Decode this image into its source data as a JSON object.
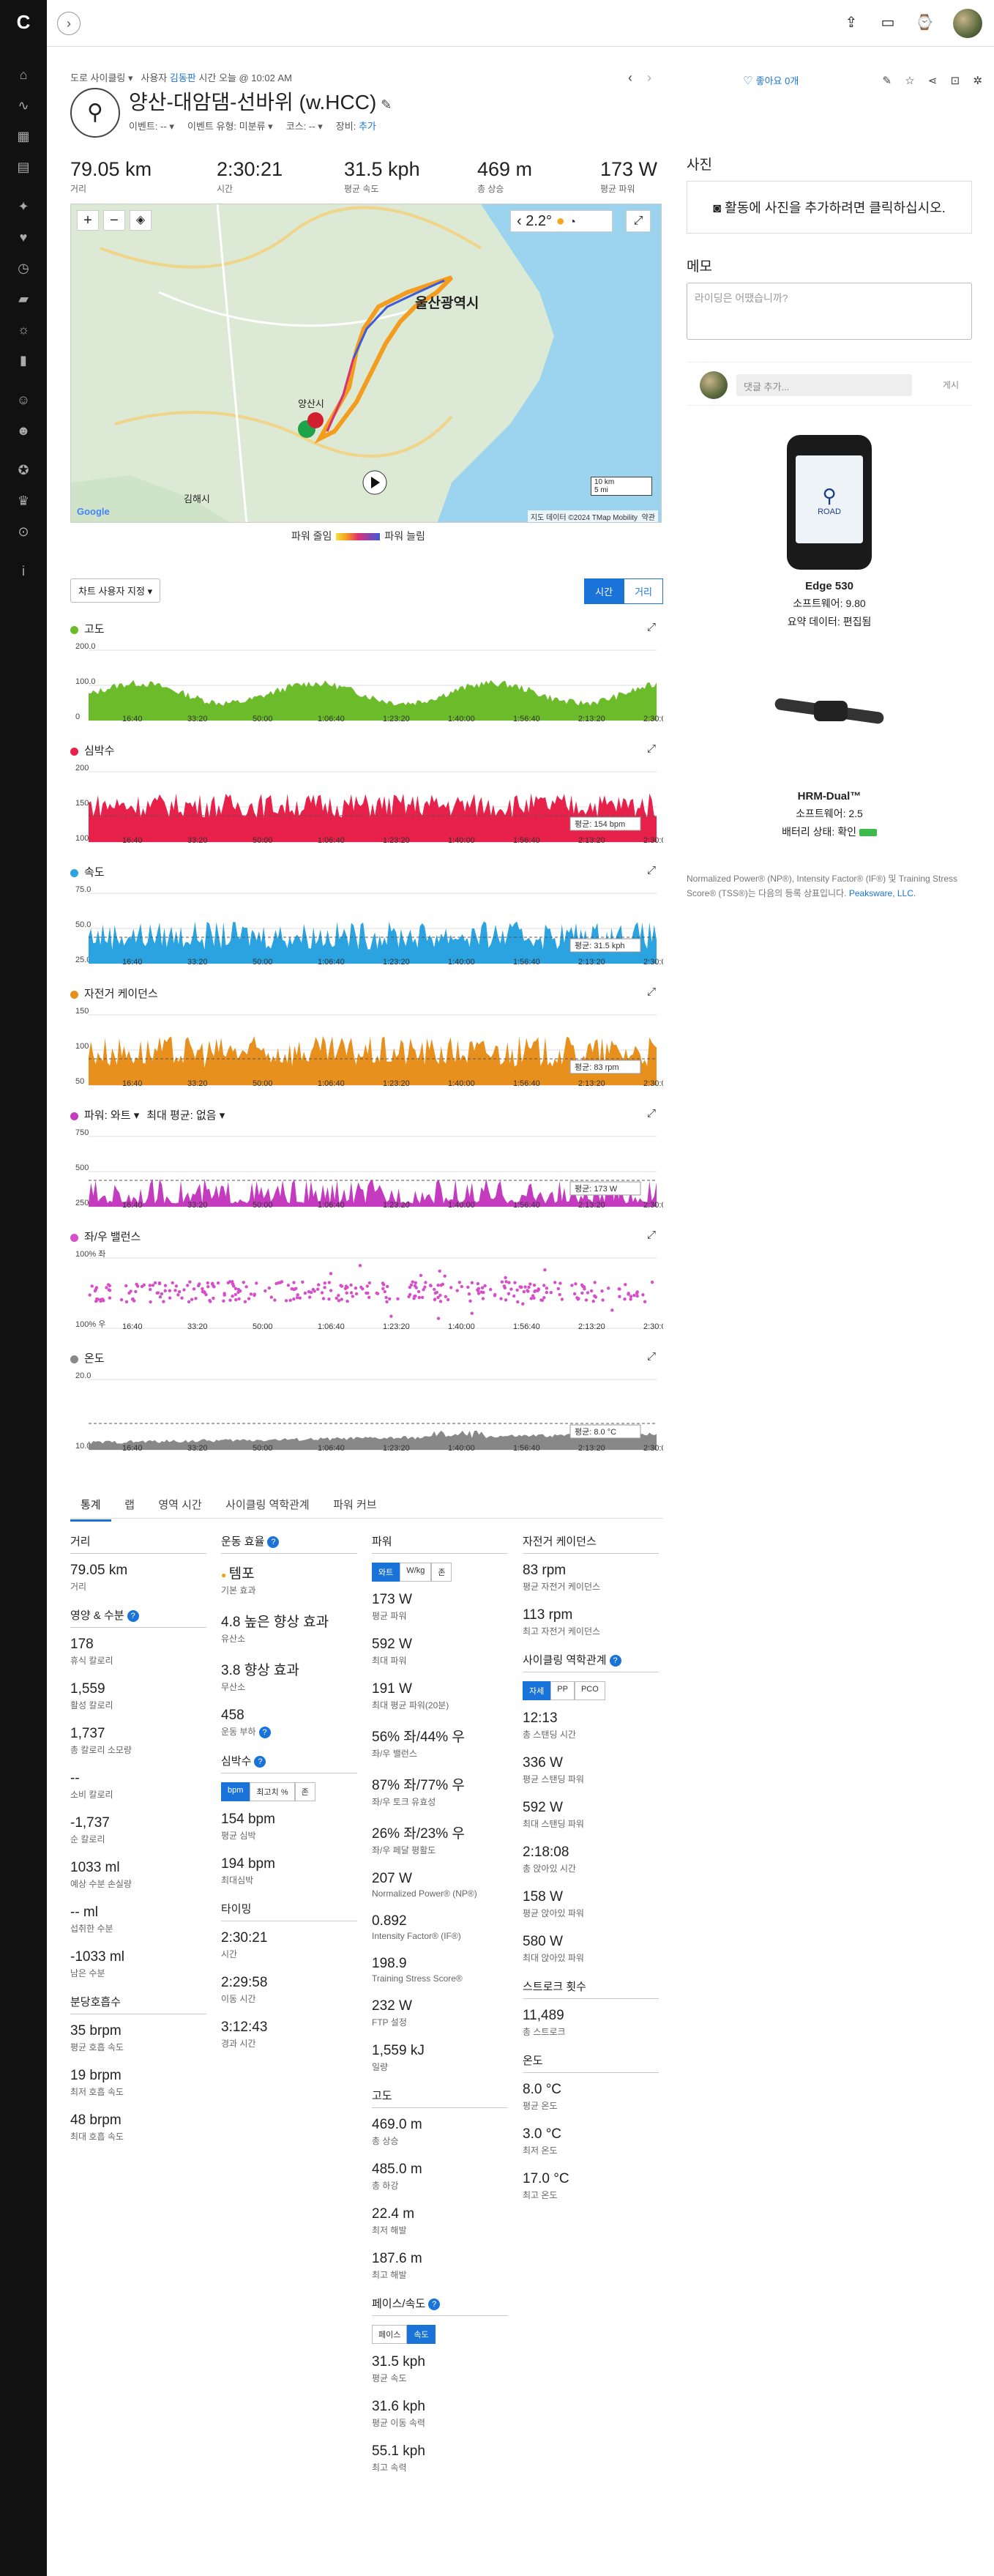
{
  "topbar": {
    "collapse_icon": "chevron-right",
    "icons": [
      "upload-icon",
      "inbox-icon",
      "watch-icon",
      "avatar"
    ]
  },
  "crumb": {
    "activity_type": "도로 사이클링",
    "user_prefix": "사용자",
    "user_name": "김동판",
    "time_prefix": "시간",
    "time_value": "오늘 @ 10:02 AM"
  },
  "activity": {
    "title": "양산-대암댐-선바위 (w.HCC)",
    "event_label": "이벤트:",
    "event_value": "--",
    "event_type_label": "이벤트 유형:",
    "event_type_value": "미분류",
    "course_label": "코스:",
    "course_value": "--",
    "gear_label": "장비:",
    "gear_value": "추가",
    "like_label": "좋아요 0개"
  },
  "summary": [
    {
      "value": "79.05 km",
      "label": "거리"
    },
    {
      "value": "2:30:21",
      "label": "시간"
    },
    {
      "value": "31.5 kph",
      "label": "평균 속도"
    },
    {
      "value": "469 m",
      "label": "총 상승"
    },
    {
      "value": "173 W",
      "label": "평균 파워"
    }
  ],
  "map": {
    "city_label": "울산광역시",
    "town_label": "양산시",
    "town2_label": "김해시",
    "temp": "2.2°",
    "scale_km": "10 km",
    "scale_mi": "5 mi",
    "attribution": "지도 데이터 ©2024 TMap Mobility",
    "terms": "약관",
    "google": "Google",
    "legend_low": "파워 줄임",
    "legend_high": "파워 늘림"
  },
  "chart_controls": {
    "customize": "차트 사용자 지정",
    "time": "시간",
    "distance": "거리"
  },
  "charts": [
    {
      "key": "elev",
      "title": "고도",
      "color": "#6cbb2a",
      "ticks": [
        "200.0",
        "100.0",
        "0"
      ],
      "avg": ""
    },
    {
      "key": "hr",
      "title": "심박수",
      "color": "#e8214a",
      "ticks": [
        "200",
        "150",
        "100"
      ],
      "avg": "평균: 154 bpm"
    },
    {
      "key": "speed",
      "title": "속도",
      "color": "#2aa3e0",
      "ticks": [
        "75.0",
        "50.0",
        "25.0"
      ],
      "avg": "평균: 31.5 kph"
    },
    {
      "key": "cad",
      "title": "자전거 케이던스",
      "color": "#e8901e",
      "ticks": [
        "150",
        "100",
        "50"
      ],
      "avg": "평균: 83 rpm"
    },
    {
      "key": "power",
      "title": "파워: 와트",
      "extra": "최대 평균: 없음",
      "color": "#c53bc0",
      "ticks": [
        "750",
        "500",
        "250"
      ],
      "avg": "평균: 173 W"
    },
    {
      "key": "balance",
      "title": "좌/우 밸런스",
      "color": "#d64fc8",
      "ticks": [
        "100% 좌",
        "100% 우"
      ],
      "avg": ""
    },
    {
      "key": "temp",
      "title": "온도",
      "color": "#888888",
      "ticks": [
        "20.0",
        "10.0"
      ],
      "avg": "평균: 8.0 °C"
    }
  ],
  "x_ticks": [
    "16:40",
    "33:20",
    "50:00",
    "1:06:40",
    "1:23:20",
    "1:40:00",
    "1:56:40",
    "2:13:20",
    "2:30:00"
  ],
  "tabs": [
    "통계",
    "랩",
    "영역 시간",
    "사이클링 역학관계",
    "파워 커브"
  ],
  "stats": {
    "distance": {
      "head": "거리",
      "items": [
        {
          "v": "79.05 km",
          "l": "거리"
        }
      ]
    },
    "nutrition": {
      "head": "영양 & 수분",
      "items": [
        {
          "v": "178",
          "l": "휴식 칼로리"
        },
        {
          "v": "1,559",
          "l": "활성 칼로리"
        },
        {
          "v": "1,737",
          "l": "총 칼로리 소모량"
        },
        {
          "v": "--",
          "l": "소비 칼로리"
        },
        {
          "v": "-1,737",
          "l": "순 칼로리"
        },
        {
          "v": "1033 ml",
          "l": "예상 수분 손실량"
        },
        {
          "v": "-- ml",
          "l": "섭취한 수분"
        },
        {
          "v": "-1033 ml",
          "l": "남은 수분"
        }
      ]
    },
    "breathing": {
      "head": "분당호흡수",
      "items": [
        {
          "v": "35 brpm",
          "l": "평균 호흡 속도"
        },
        {
          "v": "19 brpm",
          "l": "최저 호흡 속도"
        },
        {
          "v": "48 brpm",
          "l": "최대 호흡 속도"
        }
      ]
    },
    "training": {
      "head": "운동 효율",
      "items": [
        {
          "v": "템포",
          "l": "기본 효과"
        },
        {
          "v": "4.8 높은 향상 효과",
          "l": "유산소"
        },
        {
          "v": "3.8 향상 효과",
          "l": "무산소"
        },
        {
          "v": "458",
          "l": "운동 부하"
        }
      ]
    },
    "heart": {
      "head": "심박수",
      "seg": [
        "bpm",
        "최고치 %",
        "존"
      ],
      "items": [
        {
          "v": "154 bpm",
          "l": "평균 심박"
        },
        {
          "v": "194 bpm",
          "l": "최대심박"
        }
      ]
    },
    "timing": {
      "head": "타이밍",
      "items": [
        {
          "v": "2:30:21",
          "l": "시간"
        },
        {
          "v": "2:29:58",
          "l": "이동 시간"
        },
        {
          "v": "3:12:43",
          "l": "경과 시간"
        }
      ]
    },
    "power": {
      "head": "파워",
      "seg": [
        "와트",
        "W/kg",
        "존"
      ],
      "items": [
        {
          "v": "173 W",
          "l": "평균 파워"
        },
        {
          "v": "592 W",
          "l": "최대 파워"
        },
        {
          "v": "191 W",
          "l": "최대 평균 파워(20분)"
        },
        {
          "v": "56% 좌/44% 우",
          "l": "좌/우 밸런스"
        },
        {
          "v": "87% 좌/77% 우",
          "l": "좌/우 토크 유효성"
        },
        {
          "v": "26% 좌/23% 우",
          "l": "좌/우 페달 평활도"
        },
        {
          "v": "207 W",
          "l": "Normalized Power® (NP®)"
        },
        {
          "v": "0.892",
          "l": "Intensity Factor® (IF®)"
        },
        {
          "v": "198.9",
          "l": "Training Stress Score®"
        },
        {
          "v": "232 W",
          "l": "FTP 설정"
        },
        {
          "v": "1,559 kJ",
          "l": "일량"
        }
      ]
    },
    "elevation": {
      "head": "고도",
      "items": [
        {
          "v": "469.0 m",
          "l": "총 상승"
        },
        {
          "v": "485.0 m",
          "l": "총 하강"
        },
        {
          "v": "22.4 m",
          "l": "최저 해발"
        },
        {
          "v": "187.6 m",
          "l": "최고 해발"
        }
      ]
    },
    "pace": {
      "head": "페이스/속도",
      "seg": [
        "페이스",
        "속도"
      ],
      "items": [
        {
          "v": "31.5 kph",
          "l": "평균 속도"
        },
        {
          "v": "31.6 kph",
          "l": "평균 이동 속력"
        },
        {
          "v": "55.1 kph",
          "l": "최고 속력"
        }
      ]
    },
    "cadence": {
      "head": "자전거 케이던스",
      "items": [
        {
          "v": "83 rpm",
          "l": "평균 자전거 케이던스"
        },
        {
          "v": "113 rpm",
          "l": "최고 자전거 케이던스"
        }
      ]
    },
    "dynamics": {
      "head": "사이클링 역학관계",
      "seg": [
        "자세",
        "PP",
        "PCO"
      ],
      "items": [
        {
          "v": "12:13",
          "l": "총 스탠딩 시간"
        },
        {
          "v": "336 W",
          "l": "평균 스탠딩 파워"
        },
        {
          "v": "592 W",
          "l": "최대 스탠딩 파워"
        },
        {
          "v": "2:18:08",
          "l": "총 앉아있 시간"
        },
        {
          "v": "158 W",
          "l": "평균 앉아있 파워"
        },
        {
          "v": "580 W",
          "l": "최대 앉아있 파워"
        }
      ]
    },
    "strokes": {
      "head": "스트로크 횟수",
      "items": [
        {
          "v": "11,489",
          "l": "총 스트로크"
        }
      ]
    },
    "temperature": {
      "head": "온도",
      "items": [
        {
          "v": "8.0 °C",
          "l": "평균 온도"
        },
        {
          "v": "3.0 °C",
          "l": "최저 온도"
        },
        {
          "v": "17.0 °C",
          "l": "최고 온도"
        }
      ]
    }
  },
  "right": {
    "photos_title": "사진",
    "photos_add": "활동에 사진을 추가하려면 클릭하십시오.",
    "notes_title": "메모",
    "notes_placeholder": "라이딩은 어땠습니까?",
    "comment_placeholder": "댓글 추가...",
    "comment_post": "게시",
    "device1_name": "Edge 530",
    "device1_sw": "소프트웨어: 9.80",
    "device1_summary": "요약 데이터: 편집됨",
    "device1_screen_label": "ROAD",
    "device2_name": "HRM-Dual™",
    "device2_sw": "소프트웨어: 2.5",
    "device2_battery": "배터리 상태: 확인",
    "disclaimer": "Normalized Power® (NP®), Intensity Factor® (IF®) 및 Training Stress Score® (TSS®)는 다음의 등록 상표입니다.",
    "disclaimer_link": "Peaksware, LLC."
  }
}
